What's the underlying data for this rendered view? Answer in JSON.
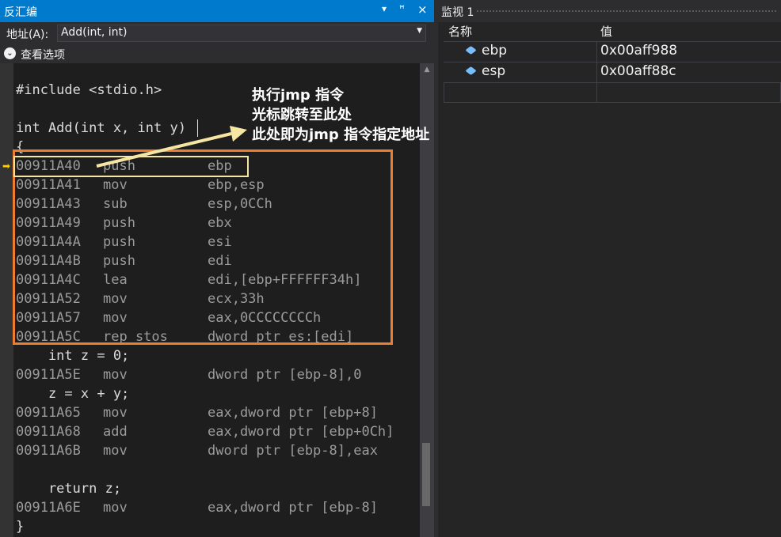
{
  "disasm_panel": {
    "title": "反汇编",
    "pin_btn": "▾",
    "dock_btn": "ꟸ",
    "close_btn": "×",
    "address_label": "地址(A):",
    "address_value": "Add(int, int)",
    "view_options_label": "查看选项"
  },
  "code_lines": [
    {
      "type": "src",
      "text": "#include <stdio.h>"
    },
    {
      "type": "src",
      "text": ""
    },
    {
      "type": "src",
      "text": "int Add(int x, int y)"
    },
    {
      "type": "src",
      "text": "{"
    },
    {
      "type": "asm",
      "addr": "00911A40",
      "mnem": "push",
      "op": "ebp"
    },
    {
      "type": "asm",
      "addr": "00911A41",
      "mnem": "mov",
      "op": "ebp,esp"
    },
    {
      "type": "asm",
      "addr": "00911A43",
      "mnem": "sub",
      "op": "esp,0CCh"
    },
    {
      "type": "asm",
      "addr": "00911A49",
      "mnem": "push",
      "op": "ebx"
    },
    {
      "type": "asm",
      "addr": "00911A4A",
      "mnem": "push",
      "op": "esi"
    },
    {
      "type": "asm",
      "addr": "00911A4B",
      "mnem": "push",
      "op": "edi"
    },
    {
      "type": "asm",
      "addr": "00911A4C",
      "mnem": "lea",
      "op": "edi,[ebp+FFFFFF34h]"
    },
    {
      "type": "asm",
      "addr": "00911A52",
      "mnem": "mov",
      "op": "ecx,33h"
    },
    {
      "type": "asm",
      "addr": "00911A57",
      "mnem": "mov",
      "op": "eax,0CCCCCCCCh"
    },
    {
      "type": "asm",
      "addr": "00911A5C",
      "mnem": "rep stos",
      "op": "dword ptr es:[edi]"
    },
    {
      "type": "src",
      "text": "    int z = 0;"
    },
    {
      "type": "asm",
      "addr": "00911A5E",
      "mnem": "mov",
      "op": "dword ptr [ebp-8],0"
    },
    {
      "type": "src",
      "text": "    z = x + y;"
    },
    {
      "type": "asm",
      "addr": "00911A65",
      "mnem": "mov",
      "op": "eax,dword ptr [ebp+8]"
    },
    {
      "type": "asm",
      "addr": "00911A68",
      "mnem": "add",
      "op": "eax,dword ptr [ebp+0Ch]"
    },
    {
      "type": "asm",
      "addr": "00911A6B",
      "mnem": "mov",
      "op": "dword ptr [ebp-8],eax"
    },
    {
      "type": "src",
      "text": ""
    },
    {
      "type": "src",
      "text": "    return z;"
    },
    {
      "type": "asm",
      "addr": "00911A6E",
      "mnem": "mov",
      "op": "eax,dword ptr [ebp-8]"
    },
    {
      "type": "src",
      "text": "}"
    }
  ],
  "annotation": {
    "lines": [
      "执行jmp 指令",
      "光标跳转至此处",
      "此处即为jmp 指令指定地址"
    ]
  },
  "watch_panel": {
    "title": "监视 1",
    "col_name": "名称",
    "col_value": "值",
    "rows": [
      {
        "name": "ebp",
        "value": "0x00aff988"
      },
      {
        "name": "esp",
        "value": "0x00aff88c"
      }
    ]
  },
  "colors": {
    "accent": "#007acc",
    "highlight_box": "#ed7d31",
    "current_line_box": "#f5e6a3",
    "ip_arrow": "#ffcc00"
  }
}
